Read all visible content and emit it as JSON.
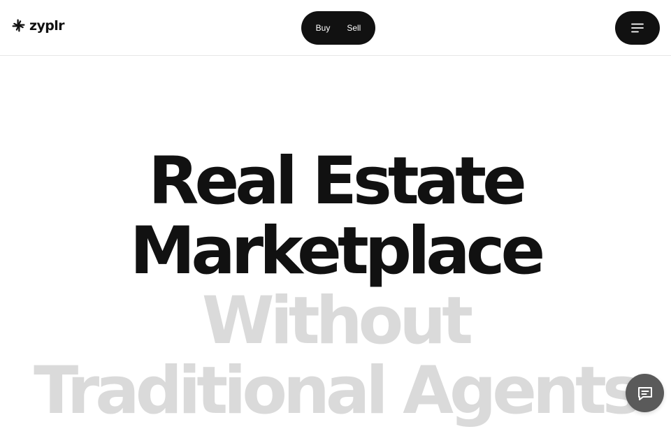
{
  "brand": {
    "name": "zyplr",
    "logo_icon": "pinwheel-logo-icon"
  },
  "nav": {
    "toggle": [
      {
        "label": "Buy"
      },
      {
        "label": "Sell"
      }
    ],
    "menu_icon": "hamburger-menu-icon"
  },
  "hero": {
    "line1": "Real Estate",
    "line2": "Marketplace",
    "line3": "Without",
    "line4": "Traditional Agents"
  },
  "chat": {
    "icon": "chat-bubble-icon"
  },
  "colors": {
    "primary": "#111111",
    "faded_text": "#dadada",
    "chat_button": "#5a5a5a",
    "background": "#ffffff"
  }
}
